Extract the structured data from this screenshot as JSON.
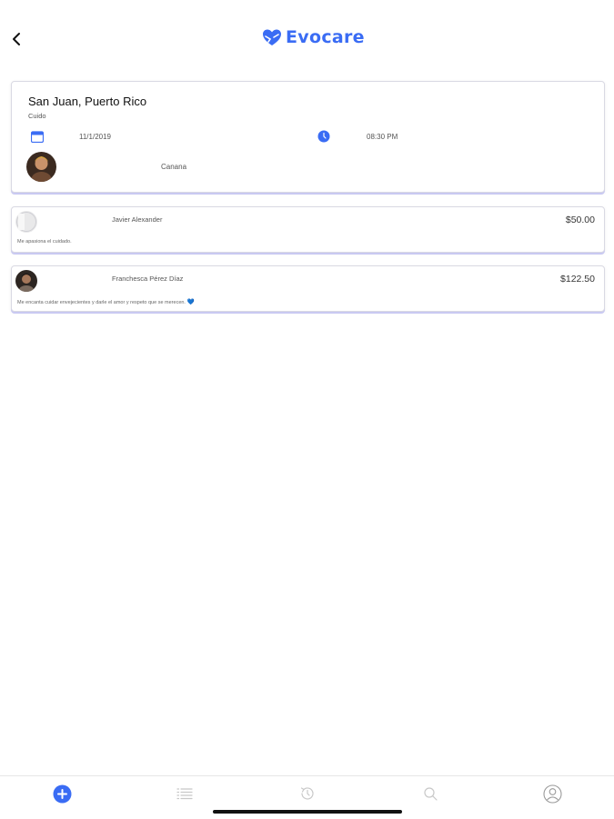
{
  "header": {
    "logo_text": "Evocare",
    "back_icon": "chevron-left-icon"
  },
  "request": {
    "location": "San Juan, Puerto Rico",
    "type": "Cuido",
    "date": "11/1/2019",
    "time": "08:30 PM",
    "name": "Canana",
    "icons": {
      "date": "calendar-icon",
      "time": "clock-icon"
    }
  },
  "offers": [
    {
      "name": "Javier Alexander",
      "price": "$50.00",
      "message": "Me apasiona el cuidado."
    },
    {
      "name": "Franchesca Pérez Díaz",
      "price": "$122.50",
      "message": "Me encanta cuidar envejecientes y darle el amor y respeto que se merecen.",
      "emoji": "💙"
    }
  ],
  "tabbar": {
    "items": [
      {
        "icon": "plus-circle-icon",
        "active": true
      },
      {
        "icon": "list-icon",
        "active": false
      },
      {
        "icon": "history-icon",
        "active": false
      },
      {
        "icon": "search-icon",
        "active": false
      },
      {
        "icon": "profile-icon",
        "active": false
      }
    ]
  },
  "colors": {
    "accent": "#3a6cf4",
    "inactive_icon": "#c8c8c8",
    "card_shadow": "#c9c9f2"
  }
}
